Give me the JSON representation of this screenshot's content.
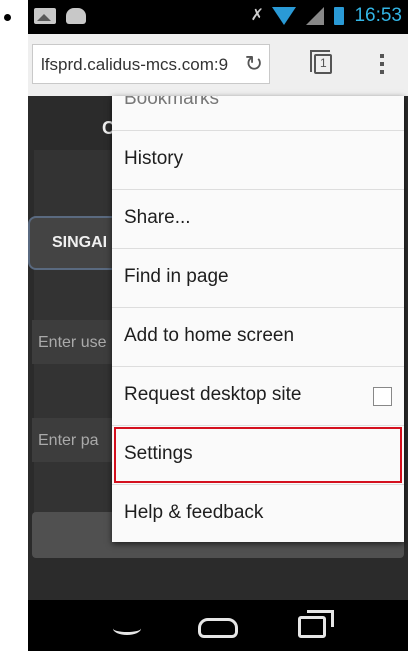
{
  "status_bar": {
    "time": "16:53"
  },
  "browser": {
    "url": "lfsprd.calidus-mcs.com:9",
    "icons": [
      "reload-icon",
      "tabs-icon",
      "overflow-menu-icon"
    ],
    "tab_count": "1"
  },
  "page": {
    "title_fragment": "C",
    "location_fragment": "SINGAI",
    "username_placeholder": "Enter use",
    "password_placeholder": "Enter pa"
  },
  "menu": {
    "cut_item": "Bookmarks",
    "items": [
      {
        "label": "History"
      },
      {
        "label": "Share..."
      },
      {
        "label": "Find in page"
      },
      {
        "label": "Add to home screen"
      },
      {
        "label": "Request desktop site",
        "checkbox": false
      },
      {
        "label": "Settings",
        "highlighted": true
      },
      {
        "label": "Help & feedback"
      }
    ]
  },
  "colors": {
    "highlight": "#d4101e",
    "status_time": "#33b5e5"
  }
}
